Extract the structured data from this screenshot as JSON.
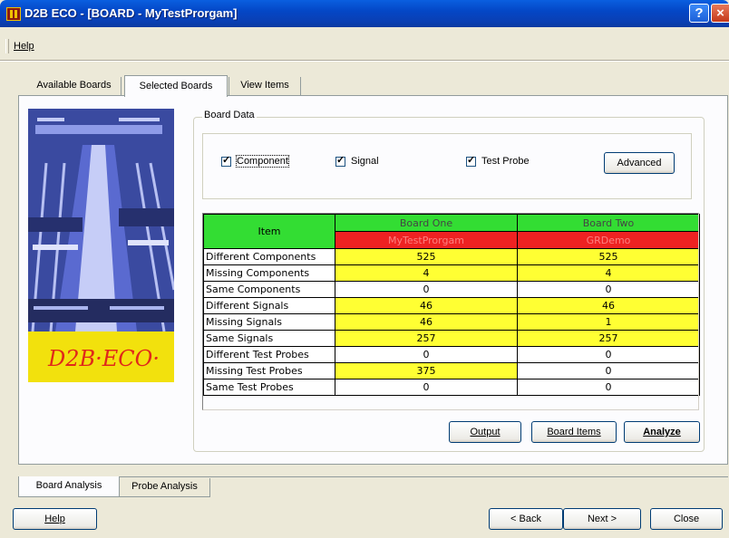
{
  "window": {
    "title": "D2B ECO - [BOARD - MyTestProrgam]",
    "help_btn": "?",
    "close_btn": "×"
  },
  "menu": {
    "help_label": "Help"
  },
  "tabs": [
    "Available Boards",
    "Selected Boards",
    "View Items"
  ],
  "picture": {
    "logo_text": "D2B·ECO·"
  },
  "board_data": {
    "legend": "Board Data",
    "checkboxes": [
      {
        "label": "Component",
        "checked": true
      },
      {
        "label": "Signal",
        "checked": true
      },
      {
        "label": "Test Probe",
        "checked": true
      }
    ],
    "advanced_label": "Advanced"
  },
  "table": {
    "item_header": "Item",
    "board_one_header": "Board One",
    "board_two_header": "Board Two",
    "board_one_name": "MyTestProrgam",
    "board_two_name": "GRDemo",
    "rows": [
      {
        "label": "Different Components",
        "one": "525",
        "two": "525",
        "one_hl": true,
        "two_hl": true
      },
      {
        "label": "Missing Components",
        "one": "4",
        "two": "4",
        "one_hl": true,
        "two_hl": true
      },
      {
        "label": "Same Components",
        "one": "0",
        "two": "0",
        "one_hl": false,
        "two_hl": false
      },
      {
        "label": "Different Signals",
        "one": "46",
        "two": "46",
        "one_hl": true,
        "two_hl": true
      },
      {
        "label": "Missing Signals",
        "one": "46",
        "two": "1",
        "one_hl": true,
        "two_hl": true
      },
      {
        "label": "Same Signals",
        "one": "257",
        "two": "257",
        "one_hl": true,
        "two_hl": true
      },
      {
        "label": "Different Test Probes",
        "one": "0",
        "two": "0",
        "one_hl": false,
        "two_hl": false
      },
      {
        "label": "Missing Test Probes",
        "one": "375",
        "two": "0",
        "one_hl": true,
        "two_hl": false
      },
      {
        "label": "Same Test Probes",
        "one": "0",
        "two": "0",
        "one_hl": false,
        "two_hl": false
      }
    ]
  },
  "actions": {
    "output": "Output",
    "board_items": "Board Items",
    "analyze": "Analyze"
  },
  "bottom_tabs": [
    "Board Analysis",
    "Probe Analysis"
  ],
  "footer": {
    "help": "Help",
    "back": "< Back",
    "next": "Next >",
    "close": "Close"
  },
  "colors": {
    "header_green": "#33dd33",
    "name_red": "#ee2222",
    "highlight_yellow": "#ffff33"
  }
}
